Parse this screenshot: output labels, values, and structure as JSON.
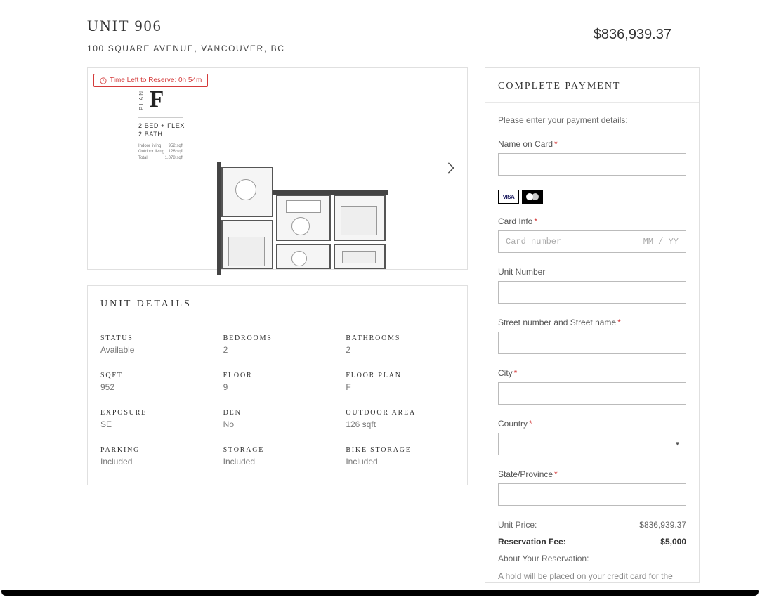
{
  "header": {
    "title": "UNIT 906",
    "address": "100 SQUARE AVENUE, VANCOUVER, BC",
    "price": "$836,939.37"
  },
  "timer": {
    "label": "Time Left to Reserve: 0h 54m"
  },
  "plan": {
    "side": "PLAN",
    "letter": "F",
    "beds": "2 BED + FLEX",
    "baths": "2 BATH",
    "specs": {
      "indoor_l": "Indoor living",
      "indoor_v": "952 sqft",
      "outdoor_l": "Outdoor living",
      "outdoor_v": "126 sqft",
      "total_l": "Total",
      "total_v": "1,078 sqft"
    }
  },
  "details": {
    "header": "UNIT DETAILS",
    "items": [
      {
        "label": "STATUS",
        "value": "Available"
      },
      {
        "label": "BEDROOMS",
        "value": "2"
      },
      {
        "label": "BATHROOMS",
        "value": "2"
      },
      {
        "label": "SQFT",
        "value": "952"
      },
      {
        "label": "FLOOR",
        "value": "9"
      },
      {
        "label": "FLOOR PLAN",
        "value": "F"
      },
      {
        "label": "EXPOSURE",
        "value": "SE"
      },
      {
        "label": "DEN",
        "value": "No"
      },
      {
        "label": "OUTDOOR AREA",
        "value": "126 sqft"
      },
      {
        "label": "PARKING",
        "value": "Included"
      },
      {
        "label": "STORAGE",
        "value": "Included"
      },
      {
        "label": "BIKE STORAGE",
        "value": "Included"
      }
    ]
  },
  "payment": {
    "title": "COMPLETE PAYMENT",
    "intro": "Please enter your payment details:",
    "labels": {
      "name": "Name on Card",
      "cardinfo": "Card Info",
      "unitnum": "Unit Number",
      "street": "Street number and Street name",
      "city": "City",
      "country": "Country",
      "state": "State/Province"
    },
    "placeholders": {
      "cardnum": "Card number",
      "cardexp": "MM / YY"
    },
    "summary": {
      "unitprice_l": "Unit Price:",
      "unitprice_v": "$836,939.37",
      "fee_l": "Reservation Fee:",
      "fee_v": "$5,000",
      "about_l": "About Your Reservation:",
      "about_t": "A hold will be placed on your credit card for the"
    }
  }
}
